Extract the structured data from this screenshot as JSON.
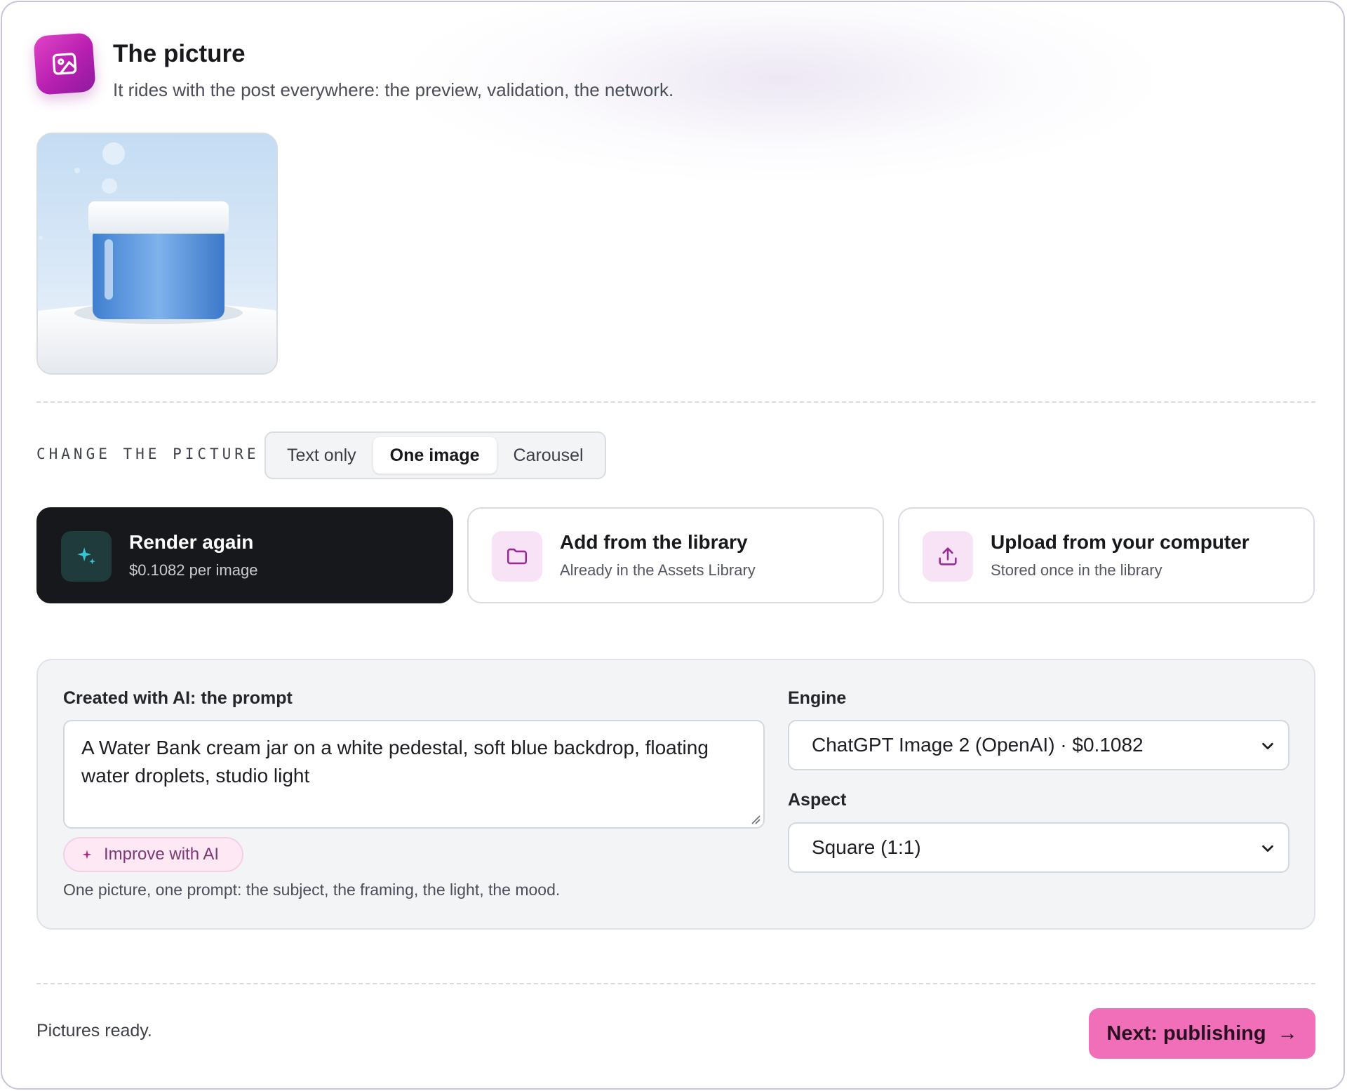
{
  "header": {
    "title": "The picture",
    "subtitle": "It rides with the post everywhere: the preview, validation, the network.",
    "icon": "image-icon"
  },
  "preview": {
    "alt": "cream jar on pedestal image preview"
  },
  "change": {
    "section_label": "CHANGE THE PICTURE",
    "modes": [
      "Text only",
      "One image",
      "Carousel"
    ],
    "selected_mode": "One image"
  },
  "options": [
    {
      "title": "Render again",
      "subtitle": "$0.1082 per image",
      "icon": "sparkles-icon"
    },
    {
      "title": "Add from the library",
      "subtitle": "Already in the Assets Library",
      "icon": "folder-icon"
    },
    {
      "title": "Upload from your computer",
      "subtitle": "Stored once in the library",
      "icon": "upload-icon"
    }
  ],
  "form": {
    "prompt_label": "Created with AI: the prompt",
    "prompt_value": "A Water Bank cream jar on a white pedestal, soft blue backdrop, floating water droplets, studio light",
    "improve_label": "Improve with AI",
    "hint": "One picture, one prompt: the subject, the framing, the light, the mood.",
    "engine_label": "Engine",
    "engine_value": "ChatGPT Image 2 (OpenAI) · $0.1082",
    "aspect_label": "Aspect",
    "aspect_value": "Square (1:1)"
  },
  "footer": {
    "status": "Pictures ready.",
    "next_label": "Next: publishing",
    "next_arrow": "→"
  },
  "colors": {
    "accent": "#f06fb8",
    "icon_gradient_start": "#e043c6",
    "dark_card": "#17181c",
    "sparkle": "#37c6d8"
  }
}
